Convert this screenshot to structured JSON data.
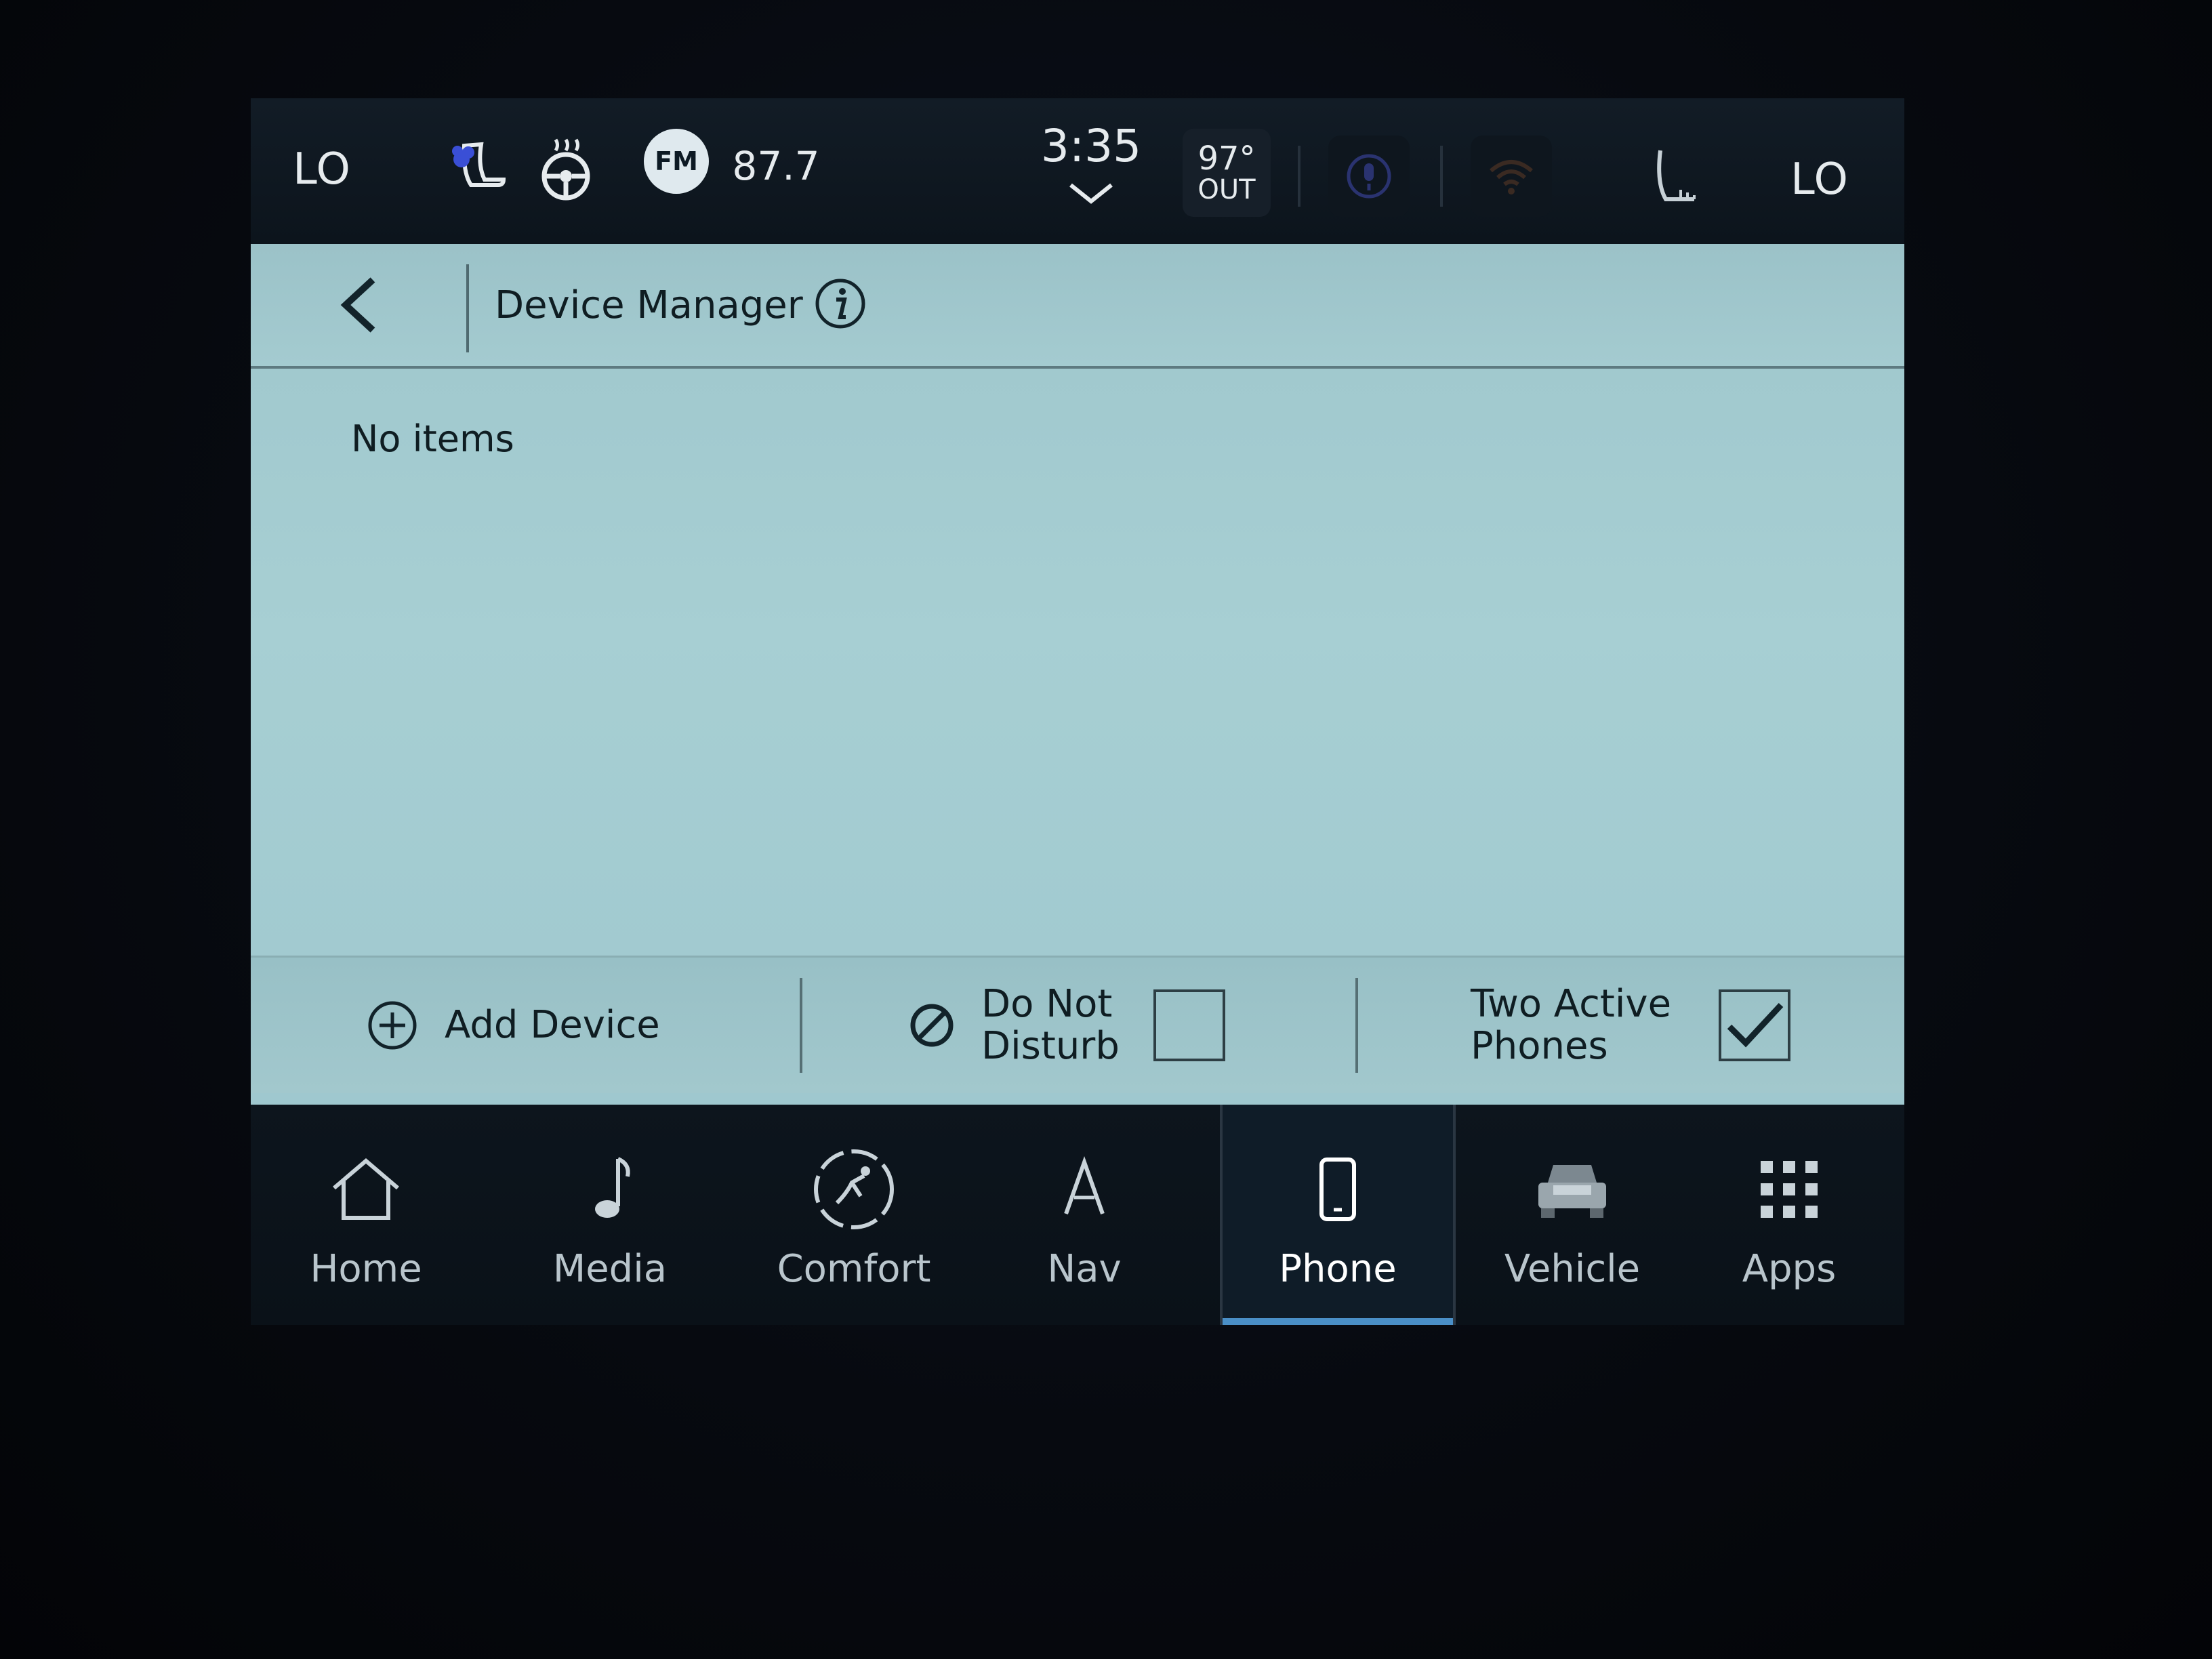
{
  "status_bar": {
    "left_temp": "LO",
    "right_temp": "LO",
    "radio_band": "FM",
    "radio_frequency": "87.7",
    "time": "3:35",
    "outside_temp": "97°",
    "outside_label": "OUT"
  },
  "header": {
    "title": "Device Manager"
  },
  "content": {
    "empty_message": "No items"
  },
  "actions": {
    "add_device": "Add Device",
    "do_not_disturb_line1": "Do Not",
    "do_not_disturb_line2": "Disturb",
    "do_not_disturb_checked": false,
    "two_active_phones_line1": "Two Active",
    "two_active_phones_line2": "Phones",
    "two_active_phones_checked": true
  },
  "nav": {
    "items": [
      {
        "label": "Home",
        "icon": "home-icon"
      },
      {
        "label": "Media",
        "icon": "music-note-icon"
      },
      {
        "label": "Comfort",
        "icon": "comfort-icon"
      },
      {
        "label": "Nav",
        "icon": "navigation-arrow-icon"
      },
      {
        "label": "Phone",
        "icon": "phone-icon",
        "active": true
      },
      {
        "label": "Vehicle",
        "icon": "truck-icon"
      },
      {
        "label": "Apps",
        "icon": "apps-grid-icon"
      }
    ]
  },
  "colors": {
    "panel_bg": "#a7cfd3",
    "nav_bg": "#0d151d",
    "active_accent": "#4a8fc7"
  }
}
